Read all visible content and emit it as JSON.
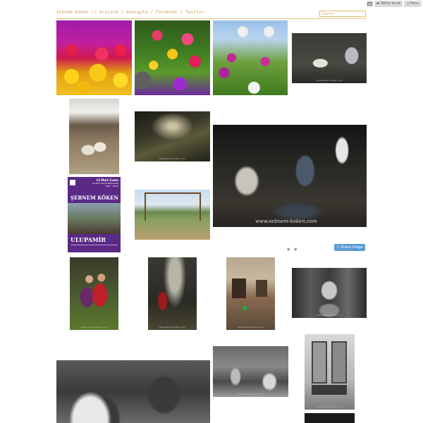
{
  "nav": {
    "text": "Şebnem Köken // Arşivim / Anasayfa / Facebook / Twitter"
  },
  "search": {
    "placeholder": "Search"
  },
  "toolbar": {
    "tekle_label": "Takibi bırak",
    "pano_label": "Pano"
  },
  "photos": {
    "watermark": "www.sebnem-koken.com",
    "main_watermark": "www.sebnem-koken.com"
  },
  "poster": {
    "date": "13 Mart Cuma",
    "venue": "Ordizili Cemal Medresesi",
    "time": "Saat : 19:00",
    "name": "ŞEBNEM KÖKEN",
    "exhibit": "ULUPAMİR"
  },
  "share": {
    "label": "Share image"
  },
  "colors": {
    "accent": "#c8a55a",
    "share": "#5b9bd5"
  }
}
